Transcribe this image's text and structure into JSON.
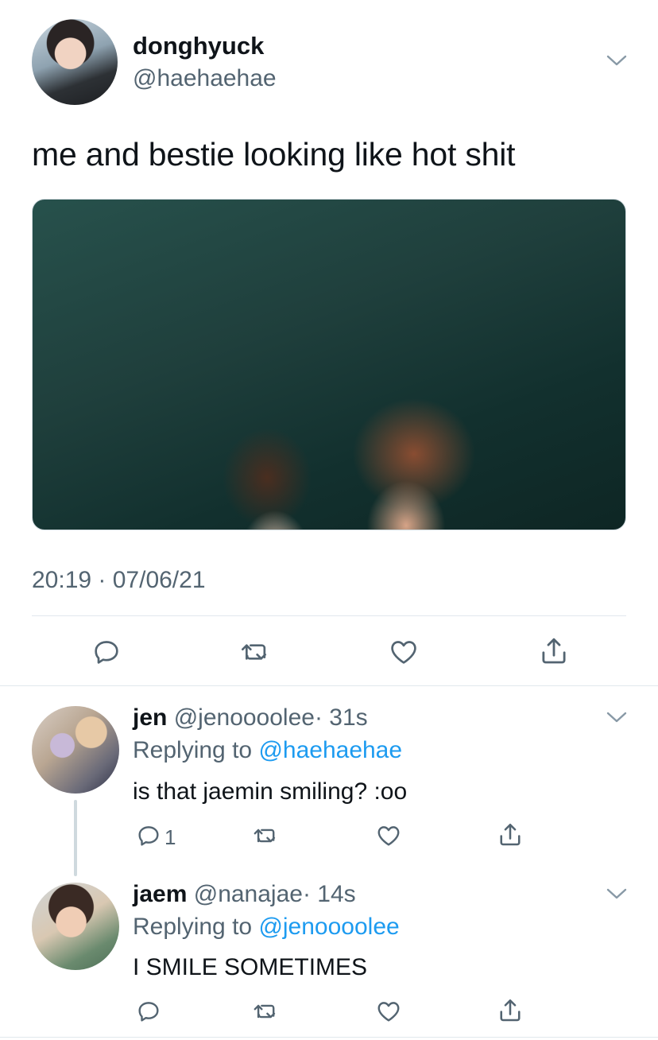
{
  "main_tweet": {
    "display_name": "donghyuck",
    "handle": "@haehaehae",
    "text": "me and bestie looking like hot shit",
    "timestamp": "20:19 · 07/06/21",
    "actions": {
      "icons": [
        "reply-icon",
        "retweet-icon",
        "like-icon",
        "share-icon"
      ]
    }
  },
  "replies": [
    {
      "display_name": "jen",
      "handle": "@jenoooolee",
      "time": "· 31s",
      "replying_prefix": "Replying to ",
      "replying_to": "@haehaehae",
      "text": "is that jaemin smiling? :oo",
      "reply_count": "1"
    },
    {
      "display_name": "jaem",
      "handle": "@nanajae",
      "time": "· 14s",
      "replying_prefix": "Replying to ",
      "replying_to": "@jenoooolee",
      "text": "I SMILE SOMETIMES",
      "reply_count": ""
    }
  ],
  "colors": {
    "accent": "#1d9bf0",
    "secondary_text": "#536471",
    "divider": "#e1e8ed"
  }
}
